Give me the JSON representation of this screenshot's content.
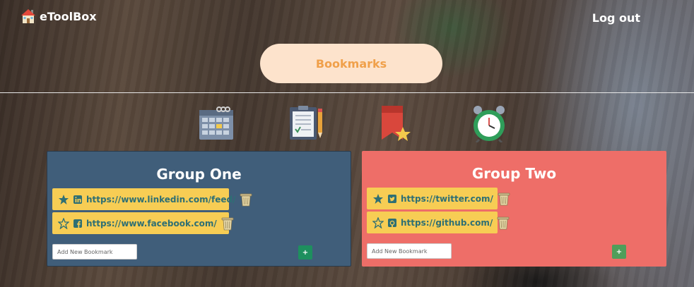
{
  "header": {
    "brand": "eToolBox",
    "logout_label": "Log out",
    "brand_icon": "house-icon"
  },
  "nav": {
    "bookmarks_label": "Bookmarks",
    "tool_icons": [
      "calendar-icon",
      "clipboard-icon",
      "bookmark-icon",
      "alarm-clock-icon"
    ]
  },
  "groups": [
    {
      "title": "Group One",
      "bookmarks": [
        {
          "url": "https://www.linkedin.com/feed/",
          "starred": true,
          "site_icon": "linkedin-icon"
        },
        {
          "url": "https://www.facebook.com/",
          "starred": false,
          "site_icon": "facebook-icon"
        }
      ],
      "add_placeholder": "Add New Bookmark",
      "add_label": "+",
      "color": "#405e7a"
    },
    {
      "title": "Group Two",
      "bookmarks": [
        {
          "url": "https://twitter.com/",
          "starred": true,
          "site_icon": "twitter-icon"
        },
        {
          "url": "https://github.com/",
          "starred": false,
          "site_icon": "github-icon"
        }
      ],
      "add_placeholder": "Add New Bookmark",
      "add_label": "+",
      "color": "#ee6e68"
    }
  ],
  "colors": {
    "bookmark_item": "#f7cd54",
    "bookmark_text": "#2e6f74",
    "pill_bg": "#fde3cc",
    "pill_text": "#f0a04a"
  }
}
